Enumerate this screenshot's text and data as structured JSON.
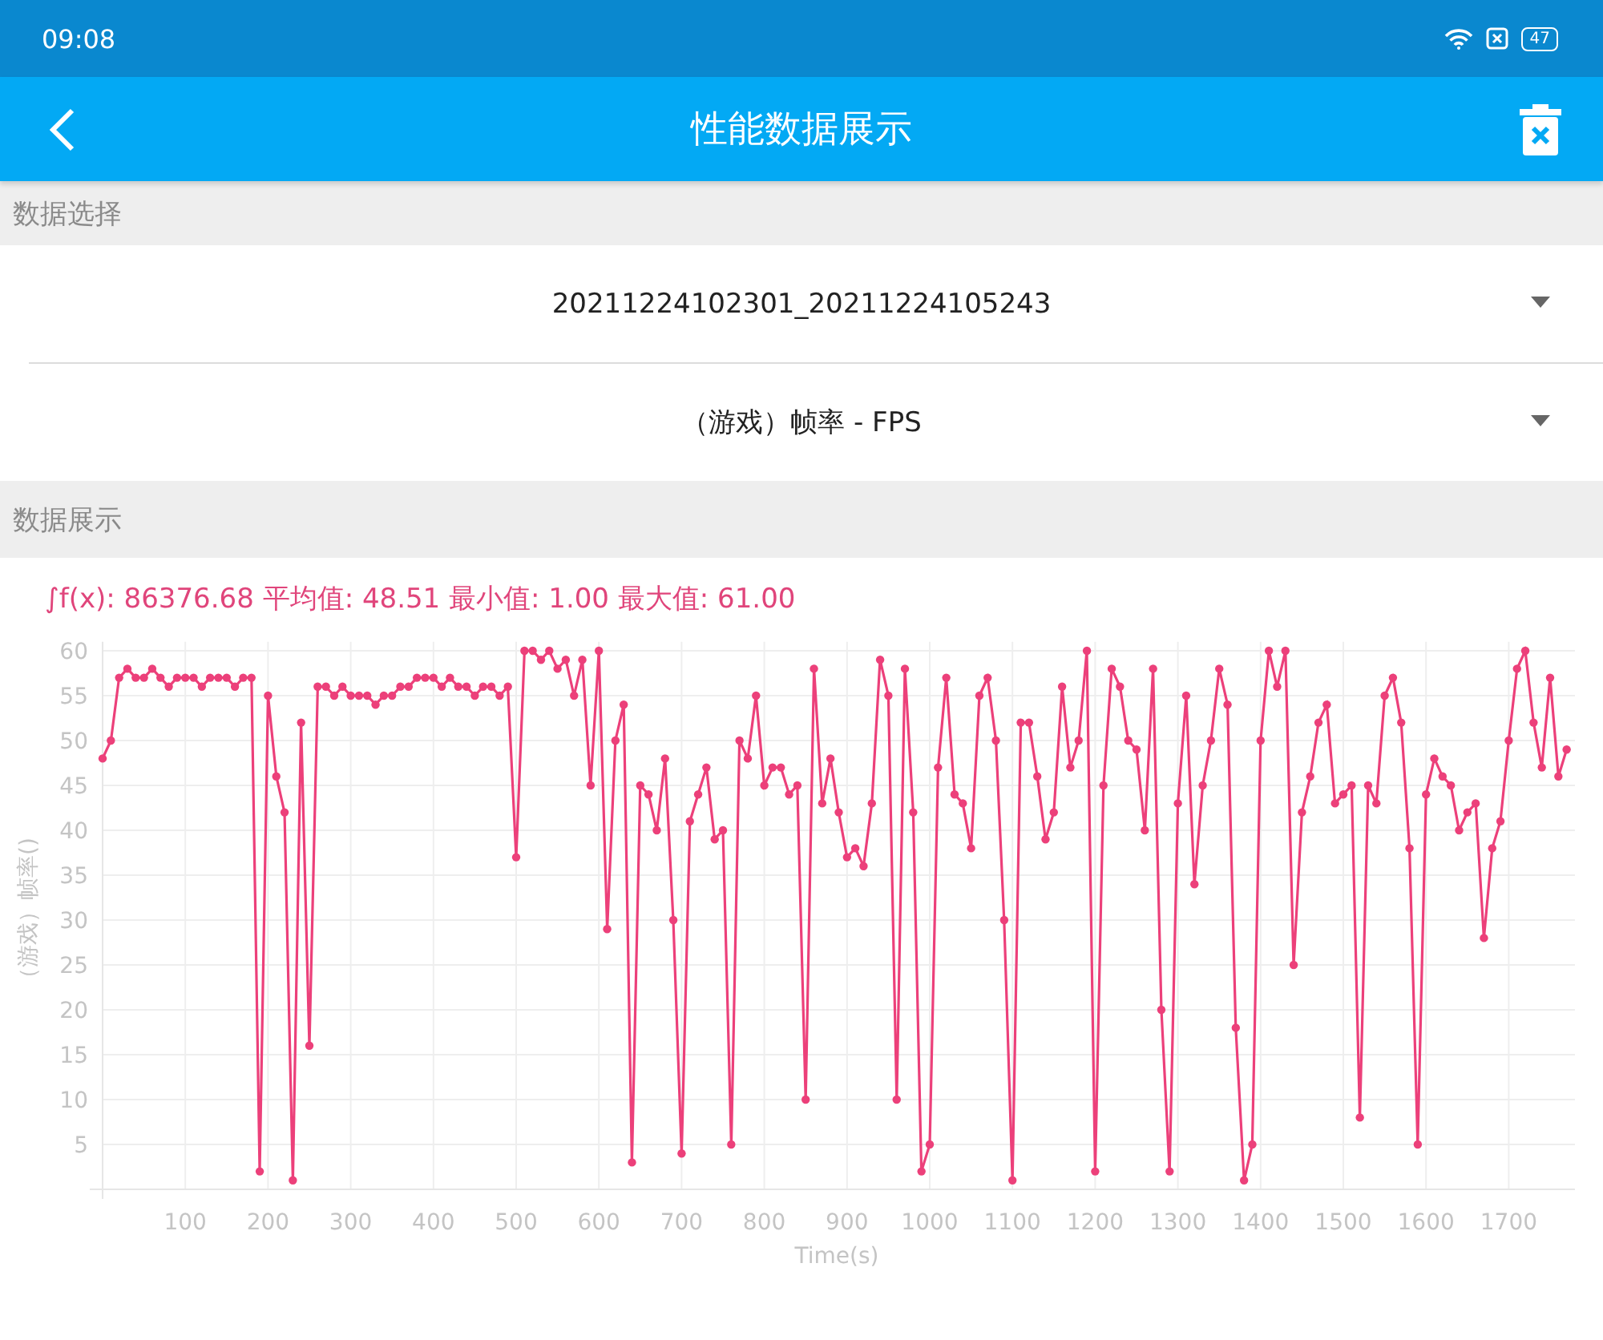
{
  "status_bar": {
    "time": "09:08",
    "battery": "47"
  },
  "app_bar": {
    "title": "性能数据展示"
  },
  "data_select": {
    "header": "数据选择",
    "dropdowns": [
      {
        "value": "20211224102301_20211224105243"
      },
      {
        "value": "（游戏）帧率 - FPS"
      }
    ]
  },
  "data_display": {
    "header": "数据展示",
    "summary": "∫f(x): 86376.68 平均值: 48.51 最小值: 1.00 最大值: 61.00",
    "chart_data": {
      "type": "line",
      "grid": true,
      "xlabel": "Time(s)",
      "ylabel": "（游戏）帧率()",
      "xlim": [
        0,
        1780
      ],
      "ylim": [
        0,
        61
      ],
      "xticks": [
        100,
        200,
        300,
        400,
        500,
        600,
        700,
        800,
        900,
        1000,
        1100,
        1200,
        1300,
        1400,
        1500,
        1600,
        1700
      ],
      "yticks": [
        5,
        10,
        15,
        20,
        25,
        30,
        35,
        40,
        45,
        50,
        55,
        60
      ],
      "x": [
        0,
        10,
        20,
        30,
        40,
        50,
        60,
        70,
        80,
        90,
        100,
        110,
        120,
        130,
        140,
        150,
        160,
        170,
        180,
        190,
        200,
        210,
        220,
        230,
        240,
        250,
        260,
        270,
        280,
        290,
        300,
        310,
        320,
        330,
        340,
        350,
        360,
        370,
        380,
        390,
        400,
        410,
        420,
        430,
        440,
        450,
        460,
        470,
        480,
        490,
        500,
        510,
        520,
        530,
        540,
        550,
        560,
        570,
        580,
        590,
        600,
        610,
        620,
        630,
        640,
        650,
        660,
        670,
        680,
        690,
        700,
        710,
        720,
        730,
        740,
        750,
        760,
        770,
        780,
        790,
        800,
        810,
        820,
        830,
        840,
        850,
        860,
        870,
        880,
        890,
        900,
        910,
        920,
        930,
        940,
        950,
        960,
        970,
        980,
        990,
        1000,
        1010,
        1020,
        1030,
        1040,
        1050,
        1060,
        1070,
        1080,
        1090,
        1100,
        1110,
        1120,
        1130,
        1140,
        1150,
        1160,
        1170,
        1180,
        1190,
        1200,
        1210,
        1220,
        1230,
        1240,
        1250,
        1260,
        1270,
        1280,
        1290,
        1300,
        1310,
        1320,
        1330,
        1340,
        1350,
        1360,
        1370,
        1380,
        1390,
        1400,
        1410,
        1420,
        1430,
        1440,
        1450,
        1460,
        1470,
        1480,
        1490,
        1500,
        1510,
        1520,
        1530,
        1540,
        1550,
        1560,
        1570,
        1580,
        1590,
        1600,
        1610,
        1620,
        1630,
        1640,
        1650,
        1660,
        1670,
        1680,
        1690,
        1700,
        1710,
        1720,
        1730,
        1740,
        1750,
        1760,
        1770
      ],
      "series": [
        {
          "color": "#ec407a",
          "marker": "circle",
          "values": [
            48,
            50,
            57,
            58,
            57,
            57,
            58,
            57,
            56,
            57,
            57,
            57,
            56,
            57,
            57,
            57,
            56,
            57,
            57,
            2,
            55,
            46,
            42,
            1,
            52,
            16,
            56,
            56,
            55,
            56,
            55,
            55,
            55,
            54,
            55,
            55,
            56,
            56,
            57,
            57,
            57,
            56,
            57,
            56,
            56,
            55,
            56,
            56,
            55,
            56,
            37,
            60,
            60,
            59,
            60,
            58,
            59,
            55,
            59,
            45,
            60,
            29,
            50,
            54,
            3,
            45,
            44,
            40,
            48,
            30,
            4,
            41,
            44,
            47,
            39,
            40,
            5,
            50,
            48,
            55,
            45,
            47,
            47,
            44,
            45,
            10,
            58,
            43,
            48,
            42,
            37,
            38,
            36,
            43,
            59,
            55,
            10,
            58,
            42,
            2,
            5,
            47,
            57,
            44,
            43,
            38,
            55,
            57,
            50,
            30,
            1,
            52,
            52,
            46,
            39,
            42,
            56,
            47,
            50,
            60,
            2,
            45,
            58,
            56,
            50,
            49,
            40,
            58,
            20,
            2,
            43,
            55,
            34,
            45,
            50,
            58,
            54,
            18,
            1,
            5,
            50,
            60,
            56,
            60,
            25,
            42,
            46,
            52,
            54,
            43,
            44,
            45,
            8,
            45,
            43,
            55,
            57,
            52,
            38,
            5,
            44,
            48,
            46,
            45,
            40,
            42,
            43,
            28,
            38,
            41,
            50,
            58,
            60,
            52,
            47,
            57,
            46,
            49
          ]
        }
      ]
    }
  }
}
